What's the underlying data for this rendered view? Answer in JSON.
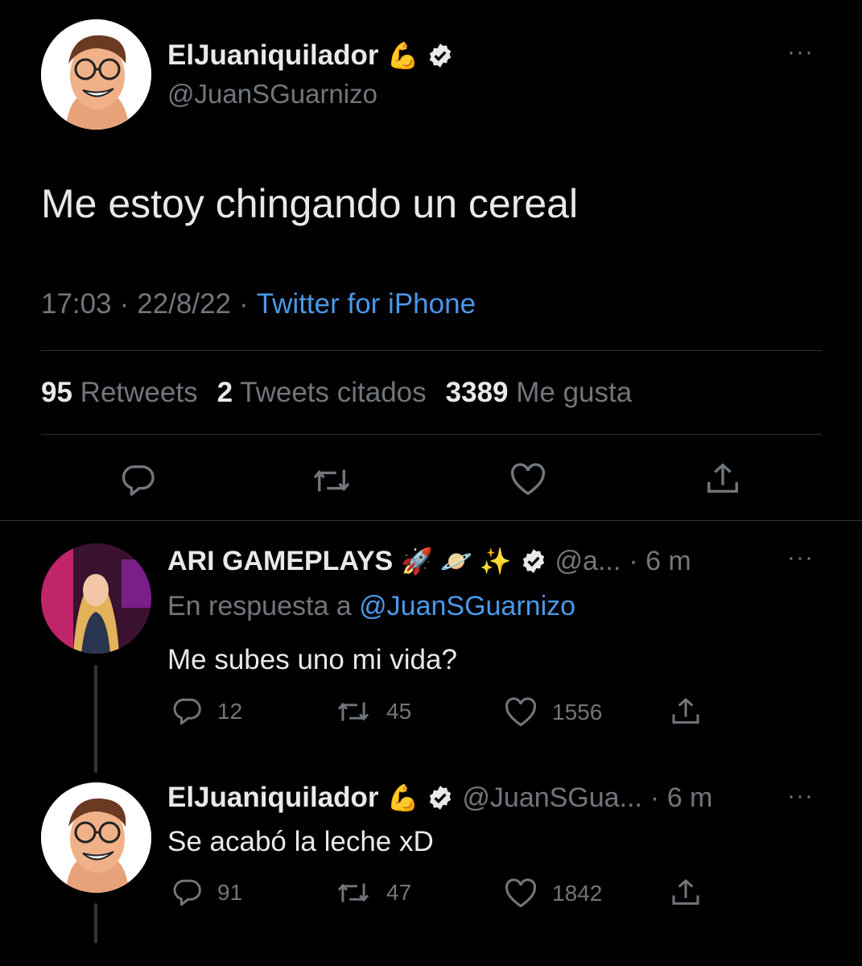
{
  "main_tweet": {
    "display_name": "ElJuaniquilador",
    "name_emoji": "💪",
    "handle": "@JuanSGuarnizo",
    "text": "Me estoy chingando un cereal",
    "time": "17:03",
    "date": "22/8/22",
    "source": "Twitter for iPhone",
    "separator": "·",
    "stats": {
      "retweets_count": "95",
      "retweets_label": "Retweets",
      "quotes_count": "2",
      "quotes_label": "Tweets citados",
      "likes_count": "3389",
      "likes_label": "Me gusta"
    },
    "more": "···"
  },
  "reply1": {
    "display_name": "ARI GAMEPLAYS",
    "emojis": "🚀 🪐 ✨",
    "handle": "@a...",
    "time": "· 6 m",
    "in_reply_prefix": "En respuesta a",
    "in_reply_handle": "@JuanSGuarnizo",
    "text": "Me subes uno mi vida?",
    "replies": "12",
    "retweets": "45",
    "likes": "1556",
    "more": "···"
  },
  "reply2": {
    "display_name": "ElJuaniquilador",
    "name_emoji": "💪",
    "handle": "@JuanSGua...",
    "time": "· 6 m",
    "text": "Se acabó la leche xD",
    "replies": "91",
    "retweets": "47",
    "likes": "1842",
    "more": "···"
  },
  "colors": {
    "background": "#000000",
    "text": "#e7e9ea",
    "muted": "#71767b",
    "link": "#4a99e9",
    "divider": "#2f3336"
  }
}
